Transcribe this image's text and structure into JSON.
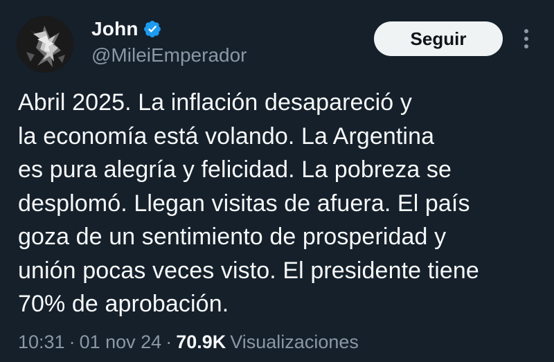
{
  "author": {
    "display_name": "John",
    "handle": "@MileiEmperador",
    "verified_icon": "verified-badge-icon",
    "avatar_icon": "avatar-image"
  },
  "actions": {
    "follow_label": "Seguir",
    "more_icon": "more-vertical-icon"
  },
  "tweet": {
    "text": "Abril 2025. La inflación desapareció y\nla economía está volando. La Argentina\nes pura alegría y felicidad. La pobreza se\ndesplomó. Llegan visitas de afuera. El país\ngoza de un sentimiento de prosperidad y\nunión pocas veces visto. El presidente tiene\n70% de aprobación."
  },
  "meta": {
    "time": "10:31",
    "separator": "·",
    "date": "01 nov 24",
    "views_count": "70.9K",
    "views_label": "Visualizaciones"
  },
  "colors": {
    "background": "#15202b",
    "text": "#f7f9f9",
    "secondary_text": "#8b98a5",
    "verified": "#1d9bf0",
    "button_bg": "#eff3f4"
  }
}
